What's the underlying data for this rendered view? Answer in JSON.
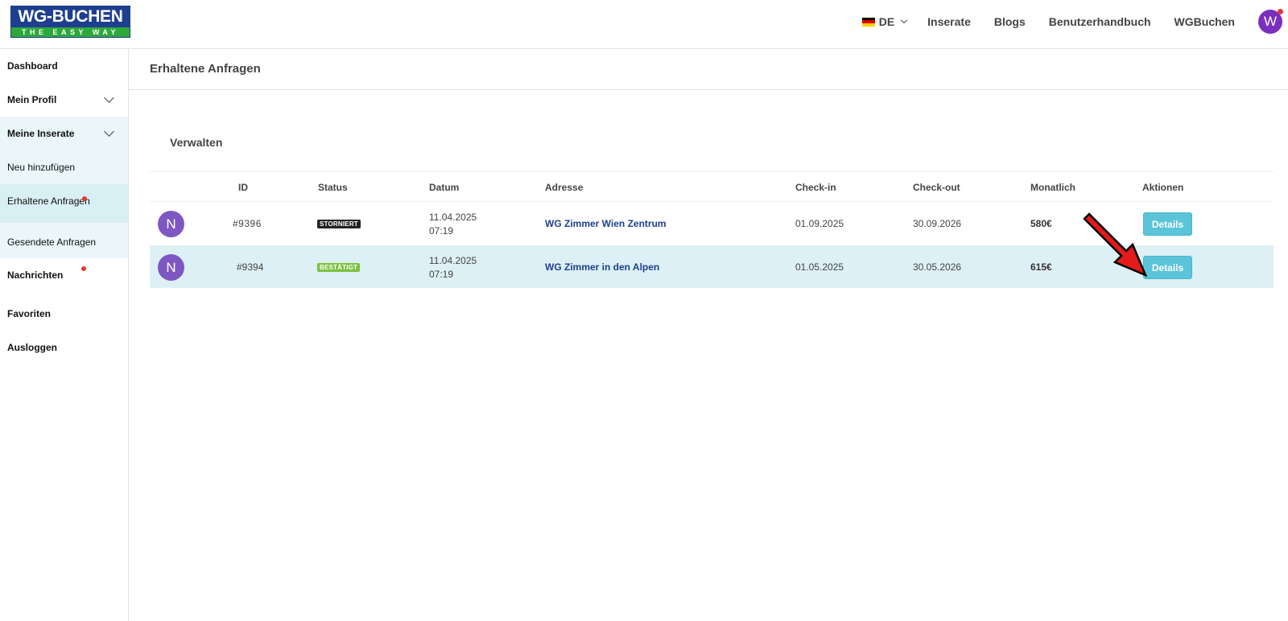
{
  "header": {
    "logo_top": "WG-BUCHEN",
    "logo_bottom": "THE EASY WAY",
    "lang": "DE",
    "nav": [
      "Inserate",
      "Blogs",
      "Benutzerhandbuch",
      "WGBuchen"
    ],
    "avatar_letter": "W"
  },
  "sidebar": {
    "items": [
      {
        "label": "Dashboard"
      },
      {
        "label": "Mein Profil"
      },
      {
        "label": "Meine Inserate"
      },
      {
        "label": "Neu hinzufügen"
      },
      {
        "label": "Erhaltene Anfragen"
      },
      {
        "label": "Gesendete Anfragen"
      },
      {
        "label": "Nachrichten"
      },
      {
        "label": "Favoriten"
      },
      {
        "label": "Ausloggen"
      }
    ]
  },
  "main": {
    "page_title": "Erhaltene Anfragen",
    "section_title": "Verwalten",
    "columns": [
      "ID",
      "Status",
      "Datum",
      "Adresse",
      "Check-in",
      "Check-out",
      "Monatlich",
      "Aktionen"
    ],
    "rows": [
      {
        "avatar": "N",
        "id": "#9396",
        "status": "STORNIERT",
        "status_color": "#222222",
        "date": "11.04.2025",
        "time": "07:19",
        "address": "WG Zimmer Wien Zentrum",
        "checkin": "01.09.2025",
        "checkout": "30.09.2026",
        "monthly": "580€",
        "action": "Details"
      },
      {
        "avatar": "N",
        "id": "#9394",
        "status": "BESTÄTIGT",
        "status_color": "#7cc142",
        "date": "11.04.2025",
        "time": "07:19",
        "address": "WG Zimmer in den Alpen",
        "checkin": "01.05.2025",
        "checkout": "30.05.2026",
        "monthly": "615€",
        "action": "Details"
      }
    ]
  },
  "colors": {
    "brand_blue": "#1e3f8f",
    "brand_green": "#2fa83a",
    "accent_button": "#5bc4d8",
    "highlight_row": "#ddf0f5",
    "annotation_arrow": "#e31b1b"
  }
}
